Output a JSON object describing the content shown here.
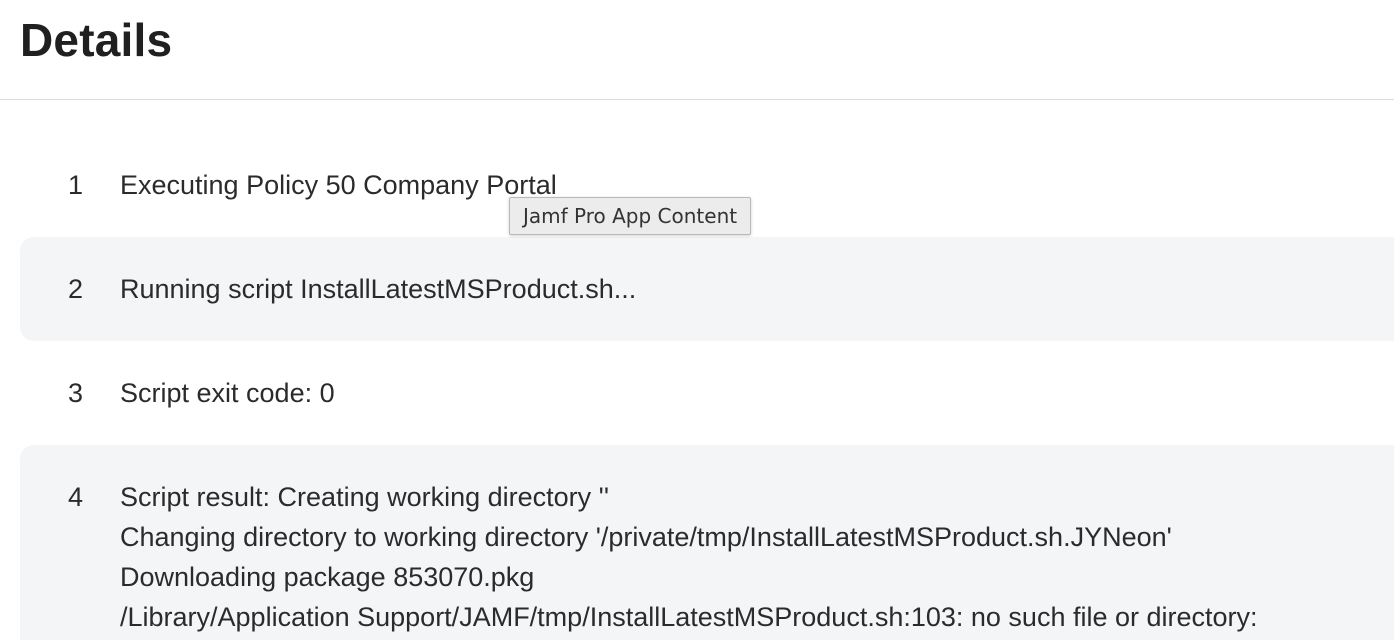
{
  "header": {
    "title": "Details"
  },
  "log": {
    "lines": [
      {
        "number": "1",
        "text": "Executing Policy 50 Company Portal"
      },
      {
        "number": "2",
        "text": "Running script InstallLatestMSProduct.sh..."
      },
      {
        "number": "3",
        "text": "Script exit code: 0"
      },
      {
        "number": "4",
        "text": "Script result: Creating working directory ''\nChanging directory to working directory '/private/tmp/InstallLatestMSProduct.sh.JYNeon'\nDownloading package 853070.pkg\n/Library/Application Support/JAMF/tmp/InstallLatestMSProduct.sh:103: no such file or directory:"
      }
    ]
  },
  "tooltip": {
    "text": "Jamf Pro App Content"
  }
}
